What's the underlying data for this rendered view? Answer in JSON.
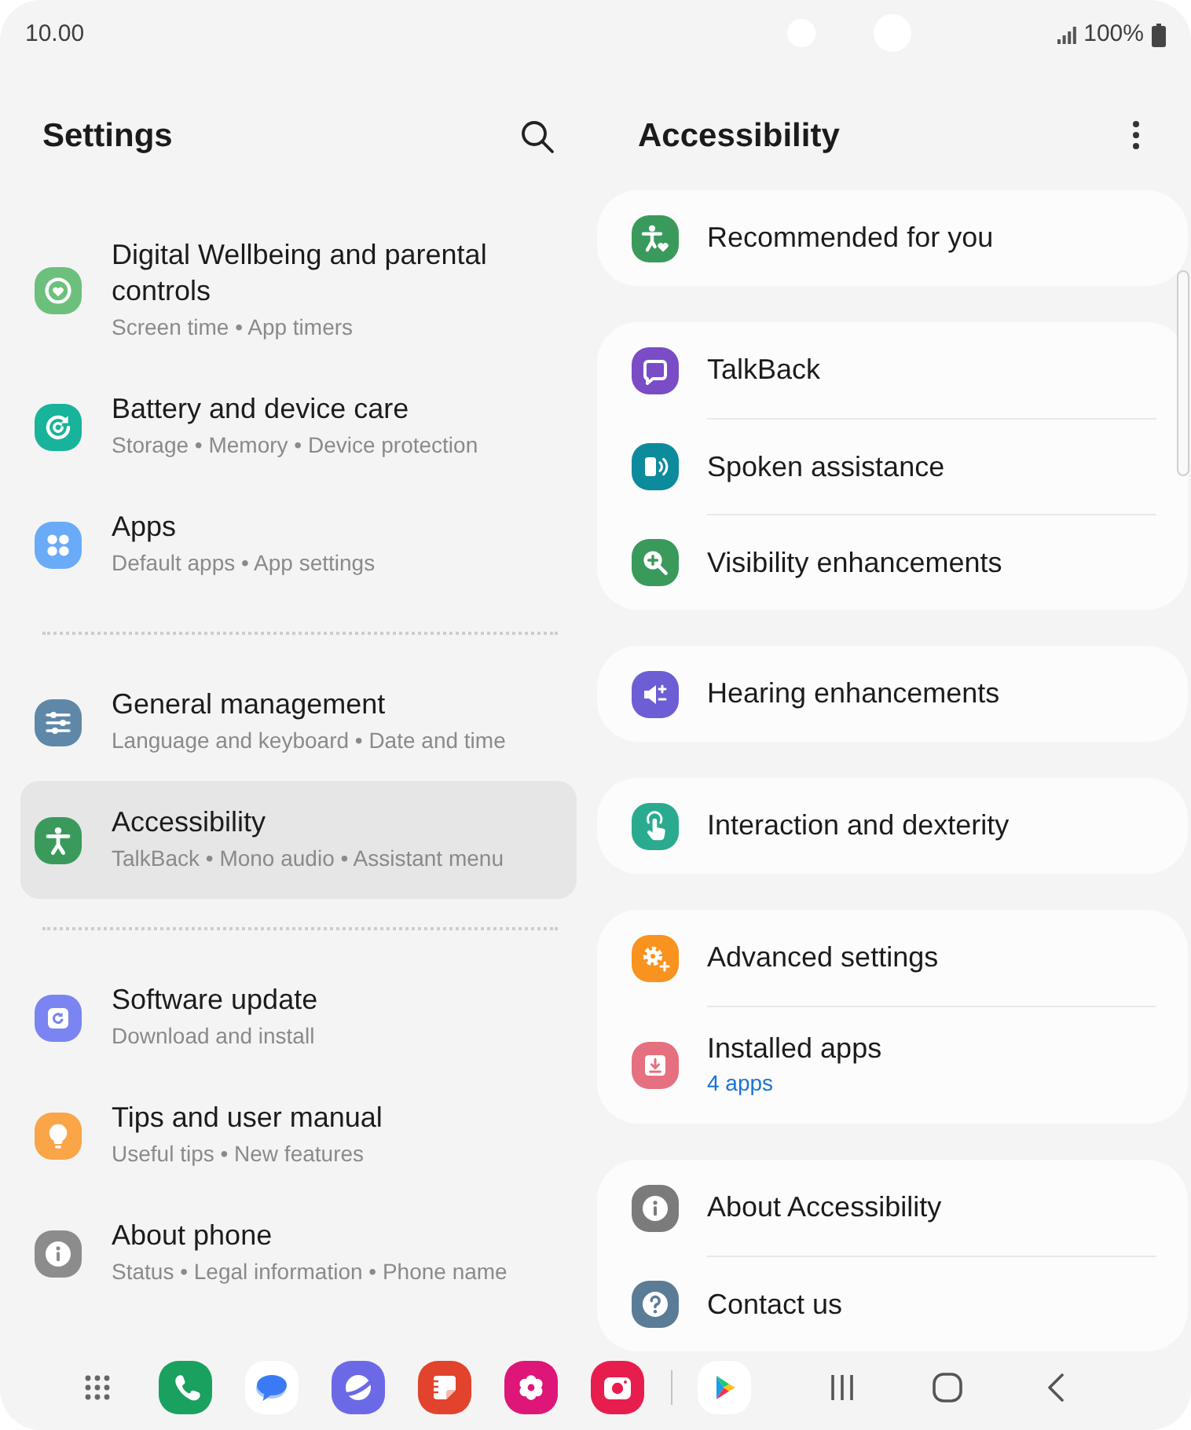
{
  "status_bar": {
    "time": "10.00",
    "battery": "100%"
  },
  "settings_panel": {
    "title": "Settings",
    "groups": [
      {
        "items": [
          {
            "title": "Digital Wellbeing and parental controls",
            "subtitle": "Screen time • App timers",
            "selected": false
          },
          {
            "title": "Battery and device care",
            "subtitle": "Storage • Memory • Device protection",
            "selected": false
          },
          {
            "title": "Apps",
            "subtitle": "Default apps • App settings",
            "selected": false
          }
        ]
      },
      {
        "items": [
          {
            "title": "General management",
            "subtitle": "Language and keyboard • Date and time",
            "selected": false
          },
          {
            "title": "Accessibility",
            "subtitle": "TalkBack • Mono audio • Assistant menu",
            "selected": true
          }
        ]
      },
      {
        "items": [
          {
            "title": "Software update",
            "subtitle": "Download and install",
            "selected": false
          },
          {
            "title": "Tips and user manual",
            "subtitle": "Useful tips • New features",
            "selected": false
          },
          {
            "title": "About phone",
            "subtitle": "Status • Legal information • Phone name",
            "selected": false
          }
        ]
      }
    ]
  },
  "accessibility_panel": {
    "title": "Accessibility",
    "cards": [
      {
        "items": [
          {
            "title": "Recommended for you"
          }
        ]
      },
      {
        "items": [
          {
            "title": "TalkBack"
          },
          {
            "title": "Spoken assistance"
          },
          {
            "title": "Visibility enhancements"
          }
        ]
      },
      {
        "items": [
          {
            "title": "Hearing enhancements"
          }
        ]
      },
      {
        "items": [
          {
            "title": "Interaction and dexterity"
          }
        ]
      },
      {
        "items": [
          {
            "title": "Advanced settings"
          },
          {
            "title": "Installed apps",
            "subtitle": "4 apps"
          }
        ]
      },
      {
        "items": [
          {
            "title": "About Accessibility"
          },
          {
            "title": "Contact us"
          }
        ]
      }
    ]
  }
}
